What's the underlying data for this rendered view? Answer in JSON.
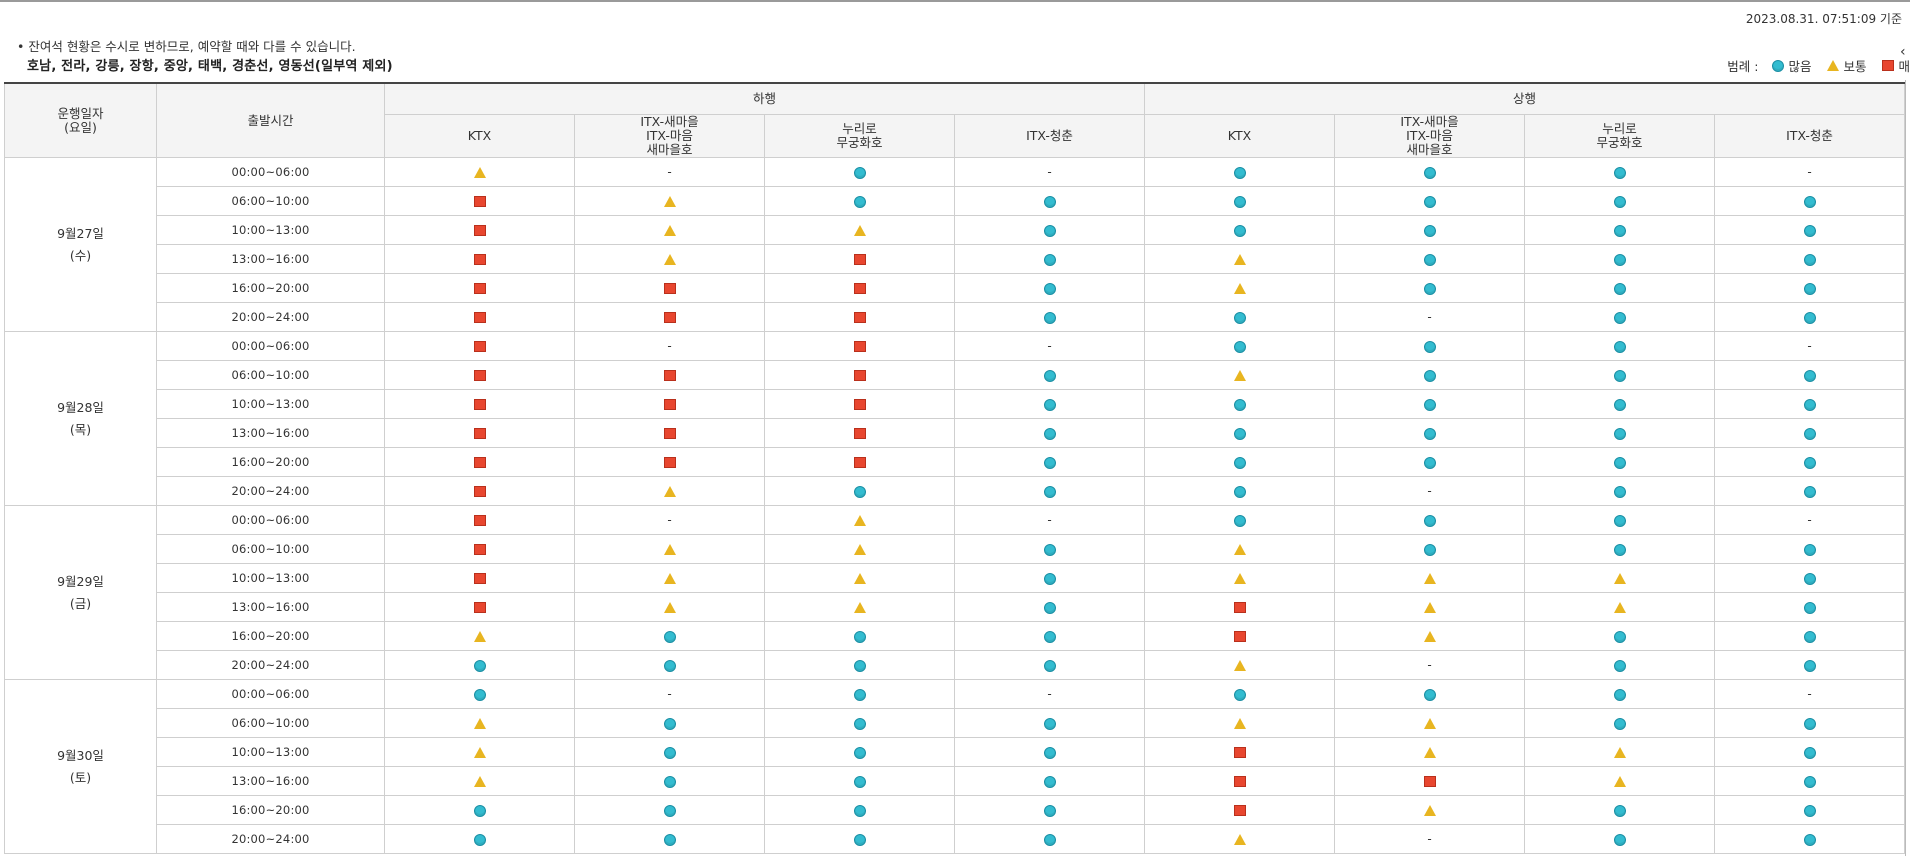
{
  "timestamp": "2023.08.31. 07:51:09 기준",
  "notice": "• 잔여석 현황은 수시로 변하므로, 예약할 때와 다를 수 있습니다.",
  "lines": "호남, 전라, 강릉, 장항, 중앙, 태백, 경춘선, 영동선(일부역 제외)",
  "legend": {
    "title": "범례 :",
    "items": [
      {
        "shape": "circle",
        "label": "많음"
      },
      {
        "shape": "triangle",
        "label": "보통"
      },
      {
        "shape": "square",
        "label": "매"
      }
    ]
  },
  "colors": {
    "many": "#33bcd0",
    "normal": "#e8b520",
    "few": "#e8462f"
  },
  "table": {
    "col_date": "운행일자\n(요일)",
    "col_time": "출발시간",
    "dir_down": "하행",
    "dir_up": "상행",
    "train_cols": [
      "KTX",
      "ITX-새마을\nITX-마음\n새마을호",
      "누리로\n무궁화호",
      "ITX-청춘"
    ],
    "dash": "-",
    "days": [
      {
        "date": "9월27일",
        "weekday": "(수)",
        "rows": [
          {
            "time": "00:00~06:00",
            "cells": [
              "T",
              "-",
              "C",
              "-",
              "C",
              "C",
              "C",
              "-"
            ]
          },
          {
            "time": "06:00~10:00",
            "cells": [
              "S",
              "T",
              "C",
              "C",
              "C",
              "C",
              "C",
              "C"
            ]
          },
          {
            "time": "10:00~13:00",
            "cells": [
              "S",
              "T",
              "T",
              "C",
              "C",
              "C",
              "C",
              "C"
            ]
          },
          {
            "time": "13:00~16:00",
            "cells": [
              "S",
              "T",
              "S",
              "C",
              "T",
              "C",
              "C",
              "C"
            ]
          },
          {
            "time": "16:00~20:00",
            "cells": [
              "S",
              "S",
              "S",
              "C",
              "T",
              "C",
              "C",
              "C"
            ]
          },
          {
            "time": "20:00~24:00",
            "cells": [
              "S",
              "S",
              "S",
              "C",
              "C",
              "-",
              "C",
              "C"
            ]
          }
        ]
      },
      {
        "date": "9월28일",
        "weekday": "(목)",
        "rows": [
          {
            "time": "00:00~06:00",
            "cells": [
              "S",
              "-",
              "S",
              "-",
              "C",
              "C",
              "C",
              "-"
            ]
          },
          {
            "time": "06:00~10:00",
            "cells": [
              "S",
              "S",
              "S",
              "C",
              "T",
              "C",
              "C",
              "C"
            ]
          },
          {
            "time": "10:00~13:00",
            "cells": [
              "S",
              "S",
              "S",
              "C",
              "C",
              "C",
              "C",
              "C"
            ]
          },
          {
            "time": "13:00~16:00",
            "cells": [
              "S",
              "S",
              "S",
              "C",
              "C",
              "C",
              "C",
              "C"
            ]
          },
          {
            "time": "16:00~20:00",
            "cells": [
              "S",
              "S",
              "S",
              "C",
              "C",
              "C",
              "C",
              "C"
            ]
          },
          {
            "time": "20:00~24:00",
            "cells": [
              "S",
              "T",
              "C",
              "C",
              "C",
              "-",
              "C",
              "C"
            ]
          }
        ]
      },
      {
        "date": "9월29일",
        "weekday": "(금)",
        "rows": [
          {
            "time": "00:00~06:00",
            "cells": [
              "S",
              "-",
              "T",
              "-",
              "C",
              "C",
              "C",
              "-"
            ]
          },
          {
            "time": "06:00~10:00",
            "cells": [
              "S",
              "T",
              "T",
              "C",
              "T",
              "C",
              "C",
              "C"
            ]
          },
          {
            "time": "10:00~13:00",
            "cells": [
              "S",
              "T",
              "T",
              "C",
              "T",
              "T",
              "T",
              "C"
            ]
          },
          {
            "time": "13:00~16:00",
            "cells": [
              "S",
              "T",
              "T",
              "C",
              "S",
              "T",
              "T",
              "C"
            ]
          },
          {
            "time": "16:00~20:00",
            "cells": [
              "T",
              "C",
              "C",
              "C",
              "S",
              "T",
              "C",
              "C"
            ]
          },
          {
            "time": "20:00~24:00",
            "cells": [
              "C",
              "C",
              "C",
              "C",
              "T",
              "-",
              "C",
              "C"
            ]
          }
        ]
      },
      {
        "date": "9월30일",
        "weekday": "(토)",
        "rows": [
          {
            "time": "00:00~06:00",
            "cells": [
              "C",
              "-",
              "C",
              "-",
              "C",
              "C",
              "C",
              "-"
            ]
          },
          {
            "time": "06:00~10:00",
            "cells": [
              "T",
              "C",
              "C",
              "C",
              "T",
              "T",
              "C",
              "C"
            ]
          },
          {
            "time": "10:00~13:00",
            "cells": [
              "T",
              "C",
              "C",
              "C",
              "S",
              "T",
              "T",
              "C"
            ]
          },
          {
            "time": "13:00~16:00",
            "cells": [
              "T",
              "C",
              "C",
              "C",
              "S",
              "S",
              "T",
              "C"
            ]
          },
          {
            "time": "16:00~20:00",
            "cells": [
              "C",
              "C",
              "C",
              "C",
              "S",
              "T",
              "C",
              "C"
            ]
          },
          {
            "time": "20:00~24:00",
            "cells": [
              "C",
              "C",
              "C",
              "C",
              "T",
              "-",
              "C",
              "C"
            ]
          }
        ]
      }
    ]
  }
}
